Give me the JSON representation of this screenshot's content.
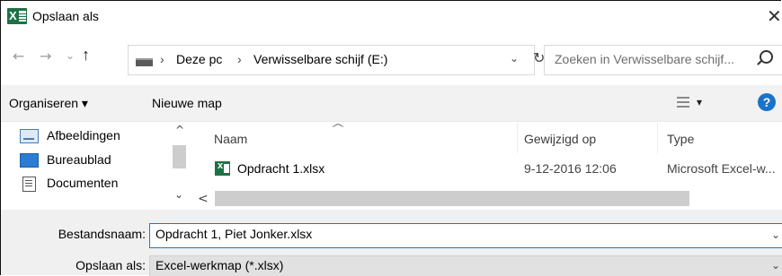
{
  "window": {
    "title": "Opslaan als",
    "close_glyph": "✕"
  },
  "address": {
    "back_glyph": "←",
    "forward_glyph": "→",
    "recent_glyph": "⌄",
    "up_glyph": "↑",
    "breadcrumb": [
      "Deze pc",
      "Verwisselbare schijf (E:)"
    ],
    "separator": "›",
    "dropdown_glyph": "⌄",
    "refresh_glyph": "↻"
  },
  "search": {
    "placeholder": "Zoeken in Verwisselbare schijf..."
  },
  "toolbar": {
    "organize_label": "Organiseren ▾",
    "new_folder_label": "Nieuwe map",
    "view_dropdown_glyph": "▾",
    "help_glyph": "?"
  },
  "navigation": {
    "items": [
      {
        "label": "Afbeeldingen",
        "icon": "pictures-icon"
      },
      {
        "label": "Bureaublad",
        "icon": "desktop-icon"
      },
      {
        "label": "Documenten",
        "icon": "documents-icon"
      }
    ],
    "scroll_up_glyph": "^",
    "scroll_down_glyph": "⌄",
    "scroll_left_glyph": "<"
  },
  "file_list": {
    "columns": [
      "Naam",
      "Gewijzigd op",
      "Type"
    ],
    "sort_glyph": "^",
    "rows": [
      {
        "name": "Opdracht 1.xlsx",
        "modified": "9-12-2016 12:06",
        "type": "Microsoft Excel-w..."
      }
    ]
  },
  "form": {
    "filename_label": "Bestandsnaam:",
    "filename_value": "Opdracht 1, Piet Jonker.xlsx",
    "savetype_label": "Opslaan als:",
    "savetype_value": "Excel-werkmap (*.xlsx)",
    "dropdown_glyph": "⌄"
  },
  "colors": {
    "excel_green": "#1e7145",
    "accent_blue": "#1979ca",
    "help_blue": "#1a73c8",
    "toolbar_bg": "#f2f2f2",
    "form_bg": "#f0f0f0"
  }
}
